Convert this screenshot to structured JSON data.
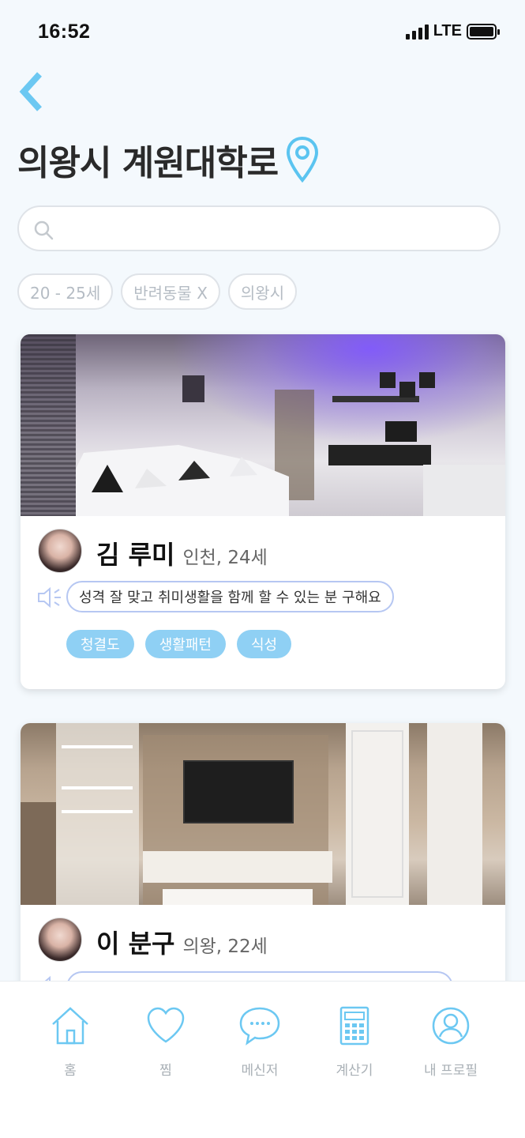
{
  "status": {
    "time": "16:52",
    "network": "LTE"
  },
  "header": {
    "title": "의왕시 계원대학로"
  },
  "search": {
    "placeholder": "",
    "value": ""
  },
  "filters": [
    "20 - 25세",
    "반려동물 X",
    "의왕시"
  ],
  "cards": [
    {
      "name": "김 루미",
      "meta": "인천, 24세",
      "intro": "성격 잘 맞고 취미생활을 함께 할 수 있는 분 구해요",
      "tags": [
        "청결도",
        "생활패턴",
        "식성"
      ]
    },
    {
      "name": "이 분구",
      "meta": "의왕, 22세",
      "intro": ""
    }
  ],
  "nav": {
    "home": "홈",
    "likes": "찜",
    "messenger": "메신저",
    "calculator": "계산기",
    "profile": "내 프로필"
  },
  "colors": {
    "accent": "#5bc4f0",
    "tag": "#8fd0f4",
    "background": "#f4f9fd"
  }
}
